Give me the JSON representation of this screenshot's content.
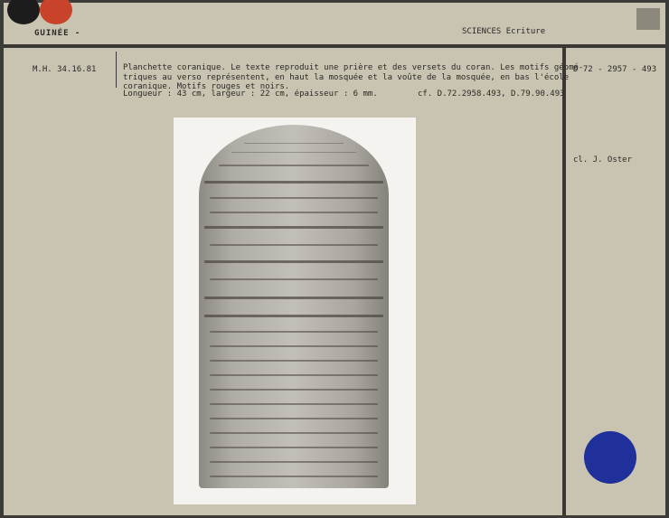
{
  "header": {
    "country": "GUINÉE -",
    "category": "SCIENCES Ecriture"
  },
  "record": {
    "inventory_number": "M.H. 34.16.81",
    "description_lines": [
      "Planchette coranique. Le texte reproduit une prière et des versets du coran. Les motifs  géomé-",
      "triques au verso représentent, en haut la mosquée et la voûte de la mosquée, en bas l'école",
      "coranique. Motifs rouges et noirs."
    ],
    "dimensions": "Longueur : 43 cm, largeur : 22 cm, épaisseur : 6 mm.",
    "cross_reference": "cf. D.72.2958.493, D.79.90.493",
    "photo_number": "D  72 - 2957 - 493",
    "photographer": "cl. J. Oster"
  },
  "colors": {
    "card_background": "#c9c3b1",
    "red_dot": "#c8432a",
    "black_dot": "#1c1c1c",
    "blue_dot": "#20309a"
  },
  "image": {
    "subject": "koranic-tablet-photo"
  }
}
